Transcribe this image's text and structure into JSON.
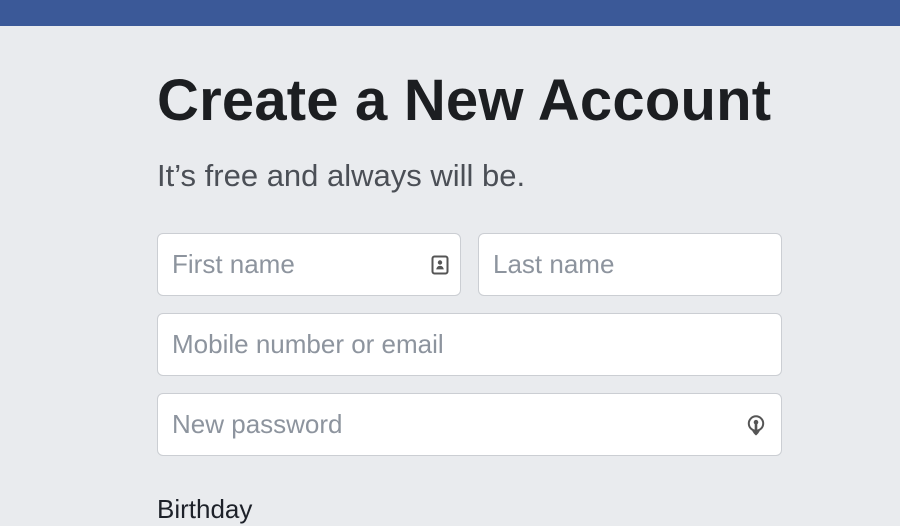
{
  "colors": {
    "header_blue": "#3b5998",
    "page_background": "#e9ebee",
    "title_text": "#1c1e21",
    "subtitle_text": "#4b4f56",
    "placeholder_text": "#8d949e",
    "input_border": "#cbced3"
  },
  "signup": {
    "title": "Create a New Account",
    "subtitle": "It’s free and always will be.",
    "first_name": {
      "value": "",
      "placeholder": "First name",
      "icon": "contact-card-icon"
    },
    "last_name": {
      "value": "",
      "placeholder": "Last name"
    },
    "mobile_or_email": {
      "value": "",
      "placeholder": "Mobile number or email"
    },
    "new_password": {
      "value": "",
      "placeholder": "New password",
      "icon": "password-key-icon"
    },
    "birthday_label": "Birthday"
  }
}
